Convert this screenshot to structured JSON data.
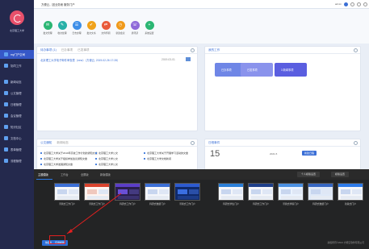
{
  "sidebar": {
    "brand": "北京理工大学",
    "items": [
      {
        "label": "my门户空间",
        "active": true
      },
      {
        "label": "协同工作"
      },
      {
        "label": "新闻动态"
      },
      {
        "label": "公文管理"
      },
      {
        "label": "日程管理"
      },
      {
        "label": "会议管理"
      },
      {
        "label": "知识社区"
      },
      {
        "label": "文档中心"
      },
      {
        "label": "表单管理"
      },
      {
        "label": "流程管理"
      }
    ]
  },
  "topbar": {
    "title": "方便云，因业务而 服务门户",
    "user": "admin"
  },
  "apps": [
    {
      "label": "发文管理",
      "color": "#2bb673",
      "glyph": "✉"
    },
    {
      "label": "收文处理",
      "color": "#27b0a8",
      "glyph": "✎"
    },
    {
      "label": "日志办理",
      "color": "#3d8ee8",
      "glyph": "☰"
    },
    {
      "label": "发文文书",
      "color": "#f0a21b",
      "glyph": "✔"
    },
    {
      "label": "文件传阅",
      "color": "#e95a3b",
      "glyph": "⇄"
    },
    {
      "label": "新建会议",
      "color": "#f09a1b",
      "glyph": "◷"
    },
    {
      "label": "通讯录",
      "color": "#8f6ad9",
      "glyph": "☏"
    },
    {
      "label": "系统设置",
      "color": "#2bb673",
      "glyph": "+"
    }
  ],
  "todo": {
    "tabs": [
      "待办事项 (1)",
      "已办事项",
      "已发事项"
    ],
    "row": "北京理工大学电子邮件审查表（new）（方便云, 2019-02-26 17:28）",
    "date": "2019-03-01"
  },
  "work": {
    "title": "我的工作",
    "cards": [
      {
        "label": "已办事项",
        "color": "#6f86e6"
      },
      {
        "label": "已发事项",
        "color": "#8a93ec"
      },
      {
        "label": "3   新闻事项",
        "color": "#5a5ee0"
      }
    ]
  },
  "docs": {
    "tabs": [
      "公文通知",
      "新闻动态"
    ],
    "items": [
      "北京理工大学关于2019年高校工作计划的通知文章",
      "北京理工大学公文",
      "北京理工大学关于开展学习活动的文章",
      "北京理工大学关于组织参加会议通知文章",
      "北京理工大学公文",
      "北京理工大学文档新闻",
      "北京理工大学发展通知文章",
      "北京理工大学公文"
    ]
  },
  "calendar": {
    "title": "日程事件",
    "day": "15",
    "month": "2021-5",
    "btn": "新建日程"
  },
  "overlay": {
    "tabs": [
      "主题模版",
      "工作台",
      "全屏版",
      "新版模版"
    ],
    "right_btns": [
      "个人模版设置",
      "模版设置"
    ],
    "thumbs": [
      "带我式工作门户",
      "带我式工作门户",
      "科研式工作门户",
      "科研式数据门户",
      "带我式工作门户",
      "科研式学生门户",
      "科研式工作门户",
      "带我式学院门户",
      "科研式数据门户",
      "新版式门户"
    ],
    "btn_left": "恢复默认",
    "btn_apply": "应用模版",
    "copyright": "版权所有©2021  方便云软件有限公司"
  },
  "colors": {
    "sidebar": "#24294d",
    "accent": "#3b6fd6",
    "highlight": "#e02020"
  }
}
